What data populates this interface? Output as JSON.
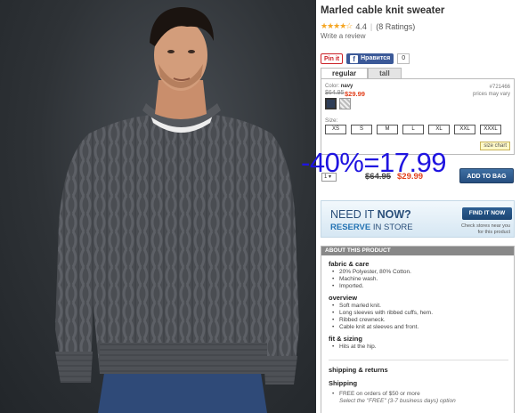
{
  "product": {
    "title": "Marled cable knit sweater",
    "rating_stars": "★★★★☆",
    "rating_value": "4.4",
    "rating_count": "(8 Ratings)",
    "write_review": "Write a review"
  },
  "social": {
    "pin_label": "Pin it",
    "fb_icon": "f",
    "fb_label": "Нравится",
    "fb_count": "0"
  },
  "tabs": [
    {
      "label": "regular",
      "active": true
    },
    {
      "label": "tall",
      "active": false
    }
  ],
  "variant": {
    "color_prefix": "Color:",
    "color_value": "navy",
    "orig_price": "$64.95",
    "sale_price": "$29.99",
    "sku": "#721466",
    "sku_note": "prices may vary",
    "size_label": "Size:",
    "sizes": [
      "XS",
      "S",
      "M",
      "L",
      "XL",
      "XXL",
      "XXXL"
    ],
    "size_chart": "size chart"
  },
  "buy": {
    "qty": "1 ▾",
    "orig_price": "$64.95",
    "sale_price": "$29.99",
    "add_to_bag": "ADD TO BAG"
  },
  "overlay": {
    "discount_text": "-40%=17.99"
  },
  "store": {
    "need_it_prefix": "NEED IT",
    "need_it_bold": "NOW?",
    "reserve_bold": "RESERVE",
    "reserve_rest": "IN STORE",
    "find_button": "FIND IT NOW",
    "find_sub_line1": "Check stores near you",
    "find_sub_line2": "for this product"
  },
  "about": {
    "header": "ABOUT THIS PRODUCT",
    "sections": [
      {
        "title": "fabric & care",
        "items": [
          "20% Polyester, 80% Cotton.",
          "Machine wash.",
          "Imported."
        ]
      },
      {
        "title": "overview",
        "items": [
          "Soft marled knit.",
          "Long sleeves with ribbed cuffs, hem.",
          "Ribbed crewneck.",
          "Cable knit at sleeves and front."
        ]
      },
      {
        "title": "fit & sizing",
        "items": [
          "Hits at the hip."
        ]
      }
    ],
    "shipping_head": "shipping & returns",
    "shipping_sub": "Shipping",
    "ship_line1": "FREE on orders of $50 or more",
    "ship_line2": "Select the \"FREE\" (3-7 business days) option"
  },
  "colors": {
    "accent_blue": "#254e7f",
    "sale_red": "#e2401c",
    "overlay_blue": "#1f14e0"
  }
}
